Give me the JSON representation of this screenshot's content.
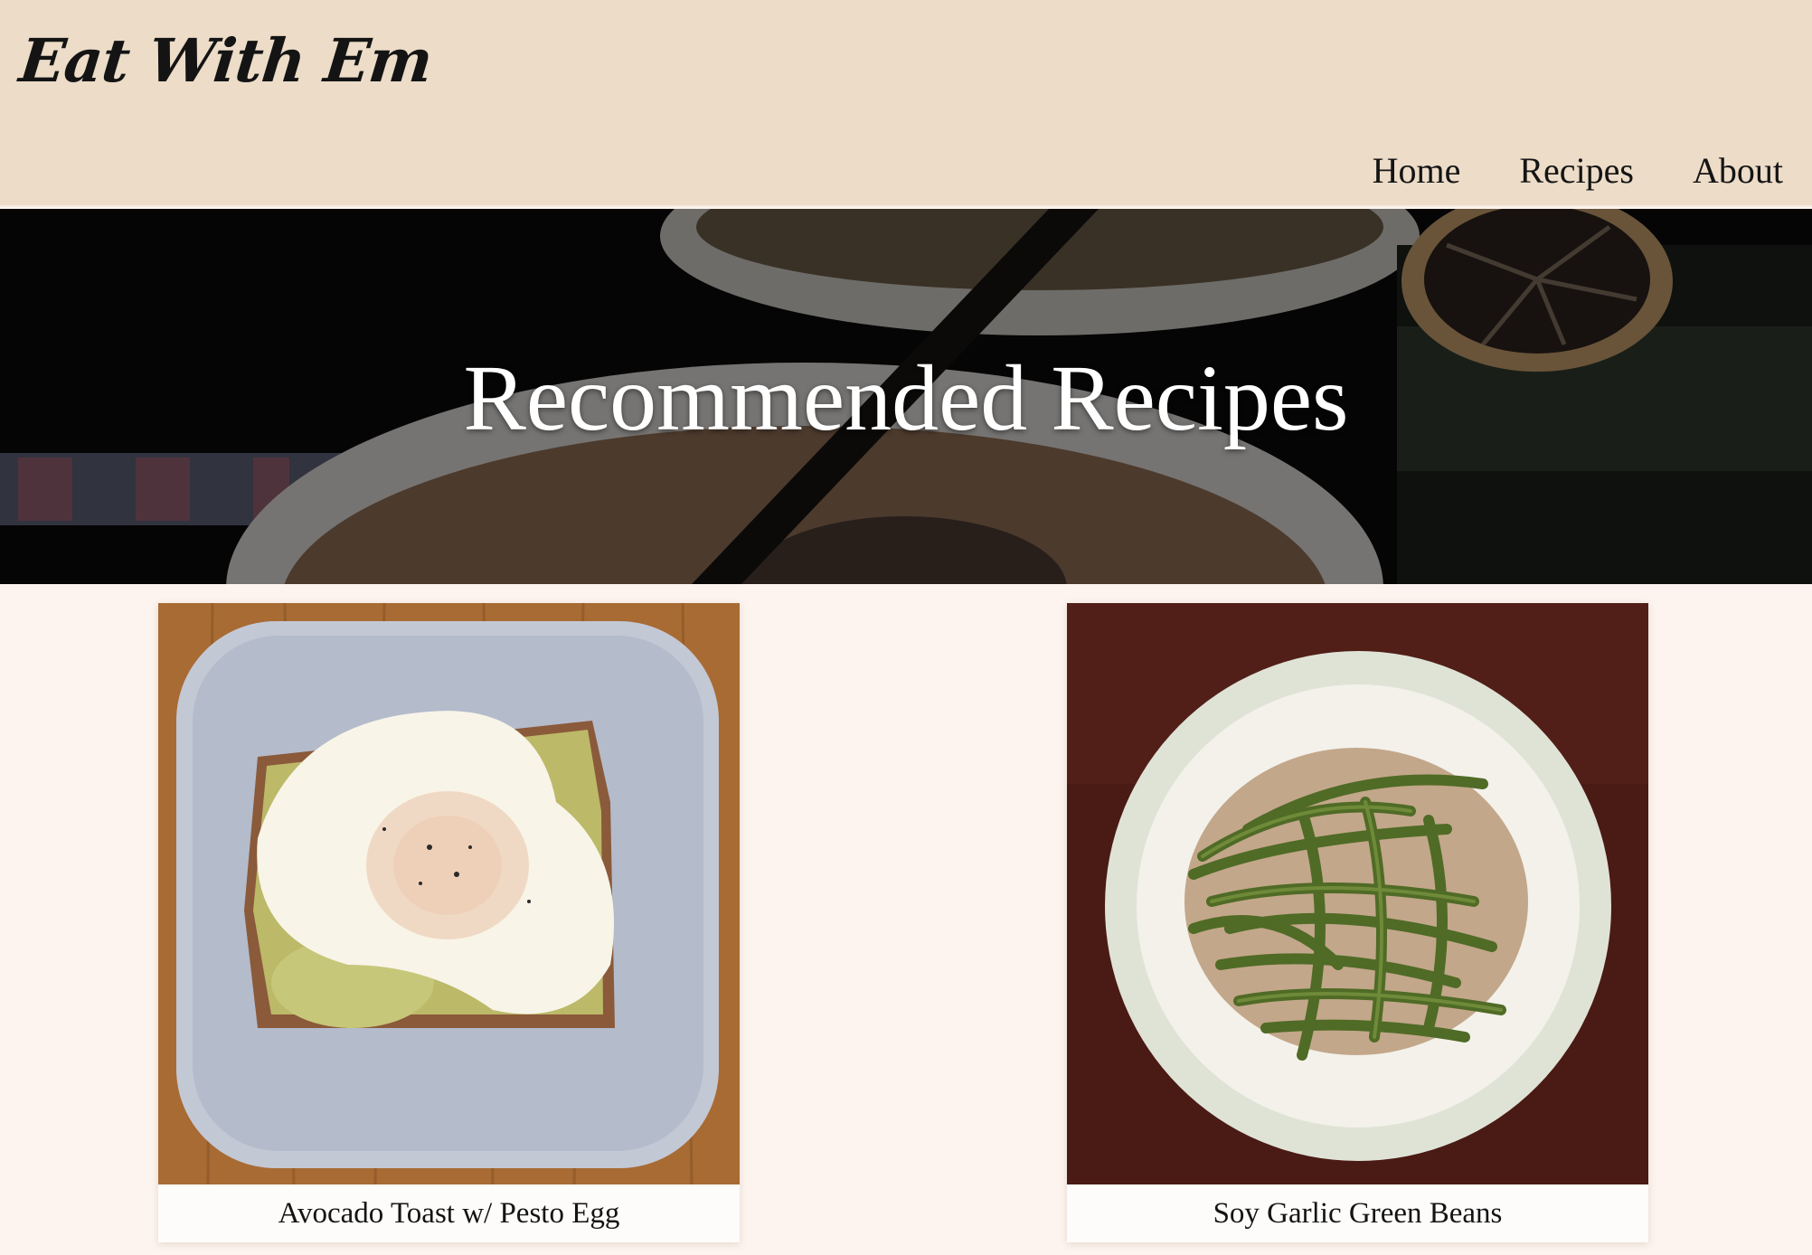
{
  "header": {
    "brand": "Eat With Em",
    "nav": [
      "Home",
      "Recipes",
      "About"
    ]
  },
  "hero": {
    "title": "Recommended Recipes"
  },
  "recipes": [
    {
      "title": "Avocado Toast w/ Pesto Egg"
    },
    {
      "title": "Soy Garlic Green Beans"
    }
  ],
  "colors": {
    "header_bg": "#ecdcc8",
    "page_bg": "#fdf4ef",
    "text": "#141414"
  }
}
